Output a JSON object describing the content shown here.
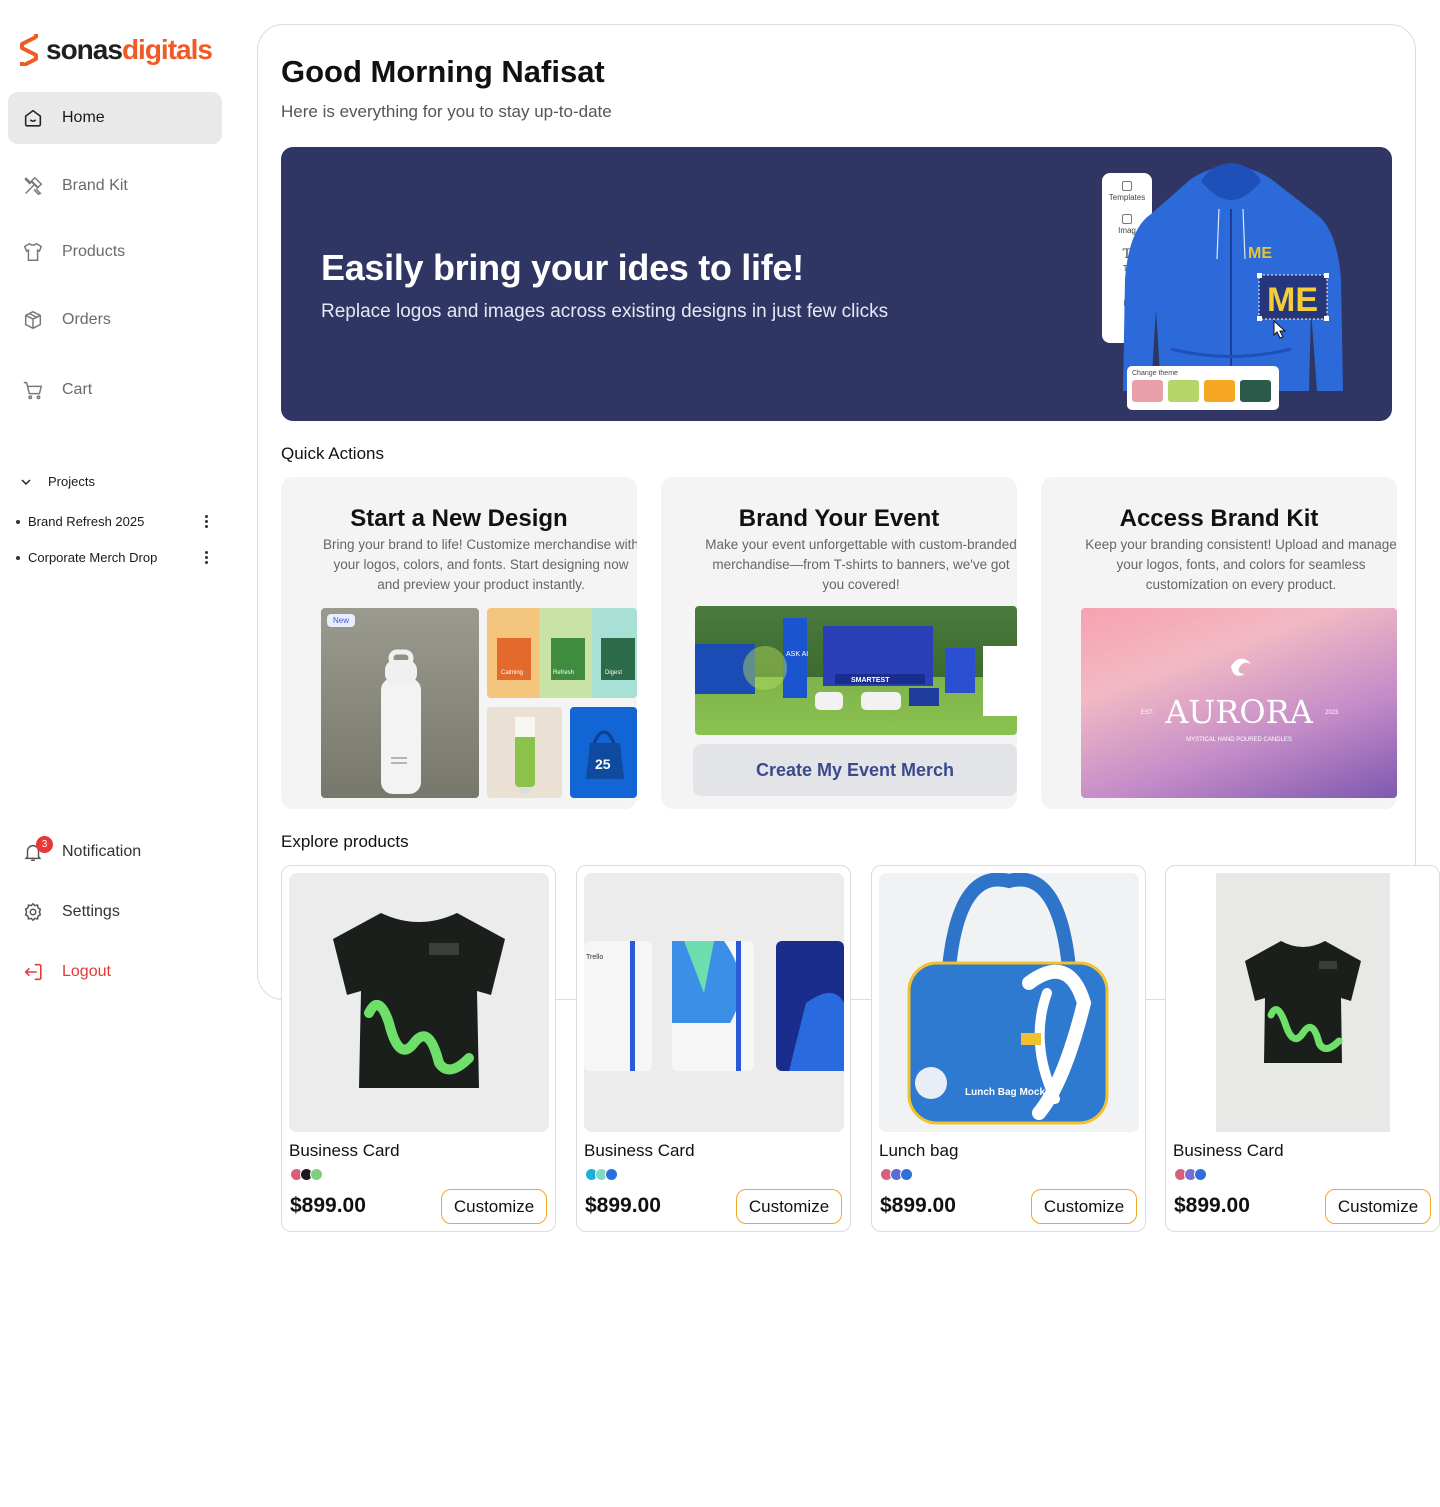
{
  "brand": {
    "name_part1": "sonas",
    "name_part2": "digitals",
    "primary": "#f15a24"
  },
  "nav": {
    "items": [
      {
        "label": "Home",
        "icon": "home-icon"
      },
      {
        "label": "Brand Kit",
        "icon": "brush-icon"
      },
      {
        "label": "Products",
        "icon": "tshirt-icon"
      },
      {
        "label": "Orders",
        "icon": "box-icon"
      },
      {
        "label": "Cart",
        "icon": "cart-icon"
      }
    ],
    "projects_label": "Projects",
    "projects": [
      "Brand Refresh 2025",
      "Corporate Merch Drop"
    ],
    "notification_label": "Notification",
    "notification_count": "3",
    "settings_label": "Settings",
    "logout_label": "Logout"
  },
  "header": {
    "greeting": "Good Morning Nafisat",
    "subtitle": "Here is everything for you to stay up-to-date"
  },
  "hero": {
    "title": "Easily bring your ides to life!",
    "subtitle": "Replace logos and images across existing designs in just few clicks",
    "editor_tools": [
      "Templates",
      "Imag",
      "Te",
      "El"
    ],
    "theme_label": "Change theme",
    "theme_colors": [
      "#e8a0a8",
      "#b5d46a",
      "#f5a623",
      "#2a5a4a"
    ],
    "logo_text": "ME",
    "background": "#303663"
  },
  "quick_actions": {
    "label": "Quick Actions",
    "cards": [
      {
        "title": "Start a New Design",
        "description": "Bring your brand to life! Customize merchandise with your logos, colors, and fonts. Start designing now and preview your product instantly.",
        "new_tag": "New",
        "box_labels": [
          "Calming",
          "Refresh",
          "Digest"
        ]
      },
      {
        "title": "Brand Your Event",
        "description": "Make your event unforgettable with custom-branded merchandise—from T-shirts to banners, we've got you covered!",
        "button": "Create My Event Merch",
        "banner_text": "SMARTEST",
        "ask_text": "ASK AI"
      },
      {
        "title": "Access Brand Kit",
        "description": "Keep your branding consistent! Upload and manage your logos, fonts, and colors for seamless customization on every product.",
        "brand_name": "AURORA",
        "brand_est": "EST.",
        "brand_year": "2023",
        "brand_tagline": "MYSTICAL HAND POURED CANDLES"
      }
    ]
  },
  "explore": {
    "label": "Explore products",
    "products": [
      {
        "name": "Business Card",
        "price": "$899.00",
        "cta": "Customize",
        "colors": [
          "#d9607a",
          "#1a1a1a",
          "#7ccf7c"
        ]
      },
      {
        "name": "Business Card",
        "price": "$899.00",
        "cta": "Customize",
        "colors": [
          "#1ab0d8",
          "#7fd9c9",
          "#2f6fd8"
        ]
      },
      {
        "name": "Lunch bag",
        "price": "$899.00",
        "cta": "Customize",
        "colors": [
          "#d9607a",
          "#5b6bd8",
          "#2f6fd8"
        ],
        "bag_text": "Lunch Bag Mockup"
      },
      {
        "name": "Business Card",
        "price": "$899.00",
        "cta": "Customize",
        "colors": [
          "#d9607a",
          "#7a6bd8",
          "#2f6fd8"
        ]
      }
    ],
    "notebook_brand": "Trello"
  }
}
